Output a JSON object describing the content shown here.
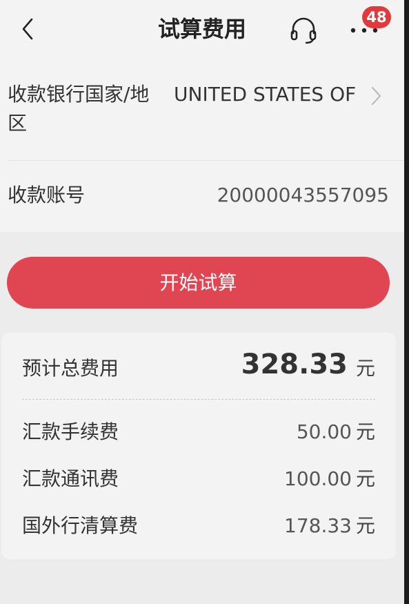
{
  "header": {
    "title": "试算费用",
    "back_icon": "chevron-left-icon",
    "service_icon": "headset-icon",
    "more_icon": "more-dots-icon",
    "badge_count": "48"
  },
  "form": {
    "country_label": "收款银行国家/地区",
    "country_value": "UNITED STATES OF",
    "account_label": "收款账号",
    "account_value": "20000043557095"
  },
  "actions": {
    "start_label": "开始试算"
  },
  "result": {
    "total_label": "预计总费用",
    "total_amount": "328.33",
    "unit": "元",
    "fees": [
      {
        "label": "汇款手续费",
        "amount": "50.00"
      },
      {
        "label": "汇款通讯费",
        "amount": "100.00"
      },
      {
        "label": "国外行清算费",
        "amount": "178.33"
      }
    ]
  },
  "colors": {
    "accent": "#e04552",
    "badge": "#e23a3c",
    "background": "#ececec",
    "card": "#f3f3f3"
  }
}
